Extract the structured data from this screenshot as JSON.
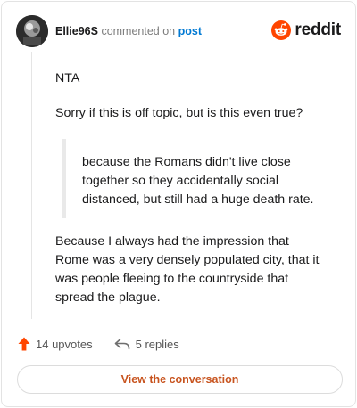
{
  "header": {
    "username": "Ellie96S",
    "action_text": "commented on",
    "post_link": "post",
    "brand": "reddit"
  },
  "comment": {
    "paragraph_1": "NTA",
    "paragraph_2": "Sorry if this is off topic, but is this even true?",
    "quote": "because the Romans didn't live close together so they accidentally social distanced, but still had a huge death rate.",
    "paragraph_3": "Because I always had the impression that Rome was a very densely populated city, that it was people fleeing to the countryside that spread the plague."
  },
  "actions": {
    "upvotes": "14 upvotes",
    "replies": "5 replies"
  },
  "button": {
    "view_label": "View the conversation"
  },
  "colors": {
    "brand": "#ff4500",
    "link": "#0079d3",
    "button_text": "#c8541f"
  },
  "icons": {
    "upvote": "upvote-arrow-icon",
    "reply": "reply-arrow-icon",
    "brand": "reddit-logo-icon"
  }
}
